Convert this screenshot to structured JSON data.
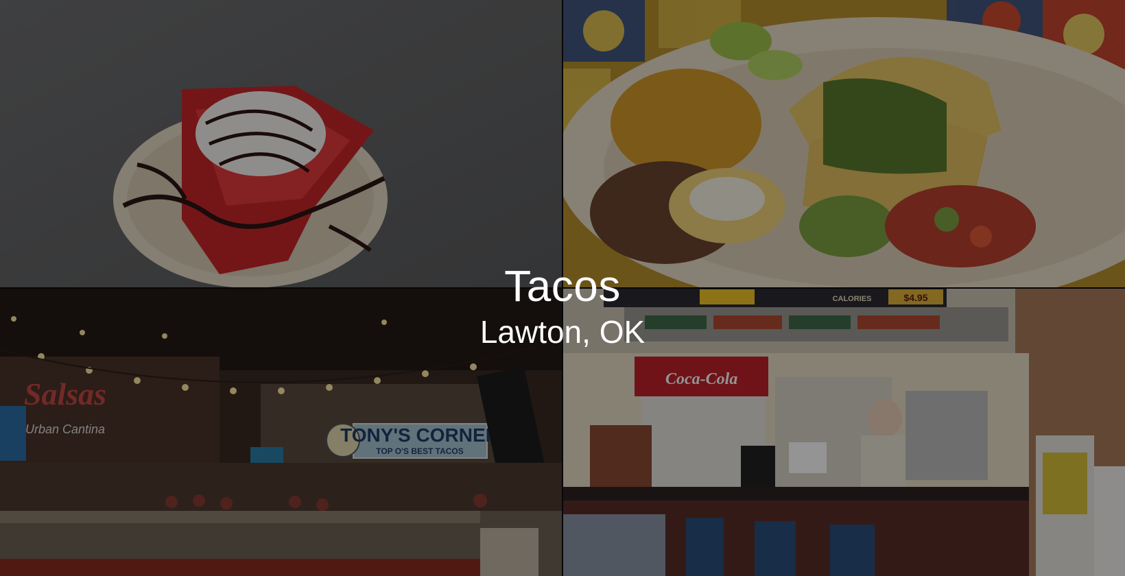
{
  "page": {
    "title": "Tacos",
    "subtitle": "Lawton, OK"
  },
  "photos": {
    "top_left": {
      "subject": "dessert-plate",
      "tone": "#6b6b6b"
    },
    "top_right": {
      "subject": "taco-plate",
      "tone": "#c9a24a"
    },
    "bottom_left": {
      "subject": "restaurant-interior",
      "signage": "TONY'S CORNER",
      "signage_sub": "TOP O'S BEST TACOS",
      "neon_sign": "Salsas",
      "neon_sub": "Urban Cantina"
    },
    "bottom_right": {
      "subject": "order-counter",
      "menu_price": "$4.95",
      "menu_calories": "CALORIES",
      "cooler_brand": "Coca-Cola"
    }
  },
  "colors": {
    "overlay": "rgba(0,0,0,0.42)",
    "caption_text": "#ffffff"
  }
}
